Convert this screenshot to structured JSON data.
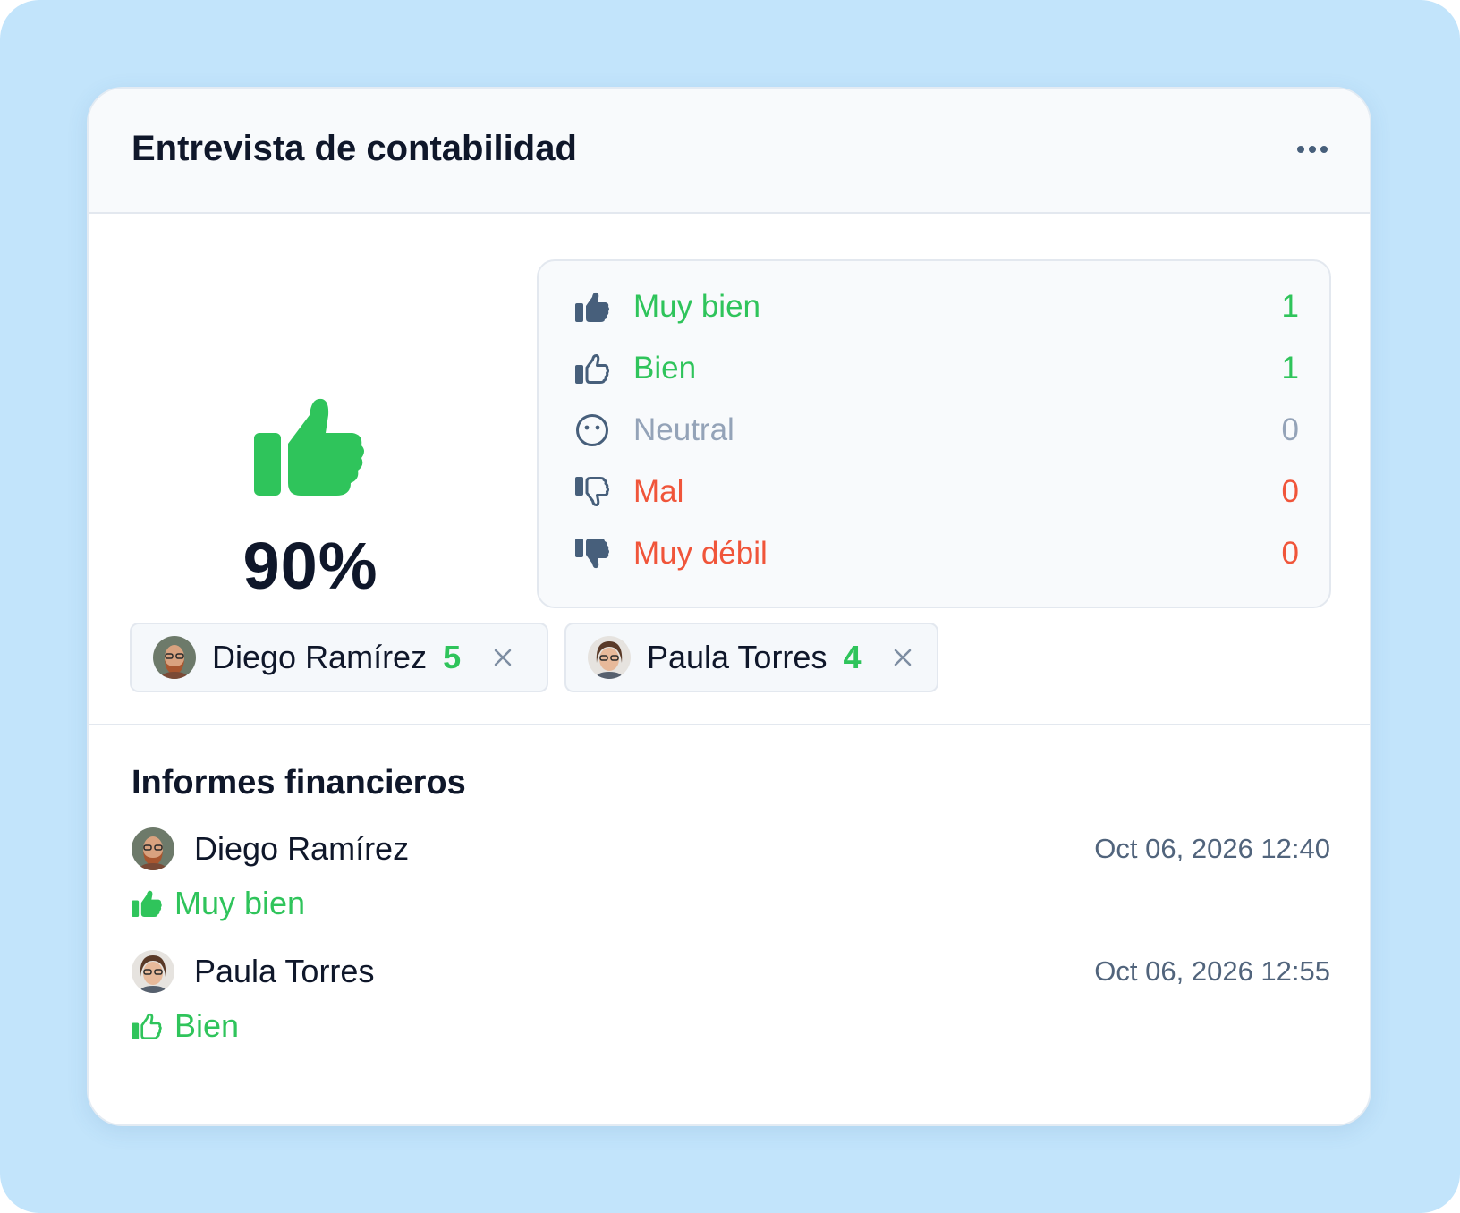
{
  "card": {
    "title": "Entrevista de contabilidad"
  },
  "summary": {
    "icon": "thumbs-up-filled-icon",
    "value": "90%"
  },
  "ratings": [
    {
      "label": "Muy bien",
      "count": "1",
      "icon": "thumbs-up-filled-icon",
      "color": "#2fc45b"
    },
    {
      "label": "Bien",
      "count": "1",
      "icon": "thumbs-up-outline-icon",
      "color": "#2fc45b"
    },
    {
      "label": "Neutral",
      "count": "0",
      "icon": "neutral-face-icon",
      "color": "#94a3b8"
    },
    {
      "label": "Mal",
      "count": "0",
      "icon": "thumbs-down-outline-icon",
      "color": "#f0553a"
    },
    {
      "label": "Muy débil",
      "count": "0",
      "icon": "thumbs-down-filled-icon",
      "color": "#f0553a"
    }
  ],
  "interviewers": [
    {
      "name": "Diego Ramírez",
      "score": "5"
    },
    {
      "name": "Paula Torres",
      "score": "4"
    }
  ],
  "section": {
    "title": "Informes financieros"
  },
  "entries": [
    {
      "name": "Diego Ramírez",
      "timestamp": "Oct 06, 2026 12:40",
      "rating": "Muy bien"
    },
    {
      "name": "Paula Torres",
      "timestamp": "Oct 06, 2026 12:55",
      "rating": "Bien"
    }
  ],
  "colors": {
    "background": "#c2e4fb",
    "positive": "#2fc45b",
    "neutral": "#94a3b8",
    "negative": "#f0553a",
    "text": "#0f172a",
    "icon": "#475f7b"
  }
}
